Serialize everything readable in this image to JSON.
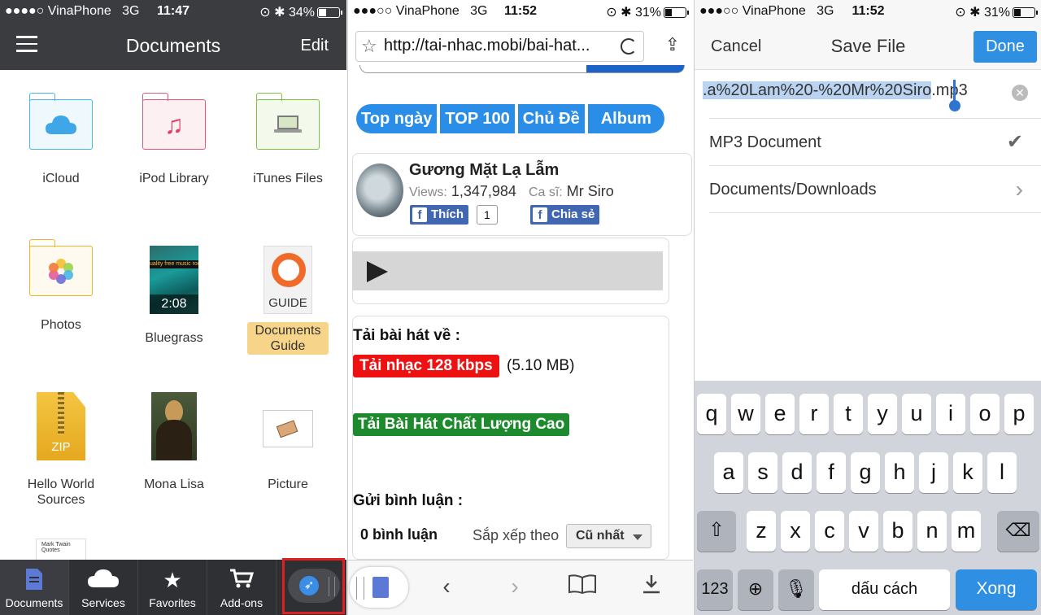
{
  "panel1": {
    "status": {
      "carrier": "●●●●○ VinaPhone",
      "network": "3G",
      "time": "11:47",
      "battery": "34%",
      "battery_level": 0.34
    },
    "header": {
      "title": "Documents",
      "edit": "Edit"
    },
    "items": [
      {
        "label": "iCloud"
      },
      {
        "label": "iPod Library"
      },
      {
        "label": "iTunes Files"
      },
      {
        "label": "Photos"
      },
      {
        "label": "Bluegrass",
        "duration": "2:08",
        "caption": "uality free music room"
      },
      {
        "label": "Documents Guide",
        "badge": "GUIDE"
      },
      {
        "label": "Hello World Sources",
        "badge": "ZIP"
      },
      {
        "label": "Mona Lisa"
      },
      {
        "label": "Picture"
      },
      {
        "label": "Mark Twain Quotes"
      }
    ],
    "tabs": [
      {
        "label": "Documents",
        "icon": "document-icon"
      },
      {
        "label": "Services",
        "icon": "cloud-icon"
      },
      {
        "label": "Favorites",
        "icon": "star-icon"
      },
      {
        "label": "Add-ons",
        "icon": "cart-icon"
      }
    ]
  },
  "panel2": {
    "status": {
      "carrier": "●●●○○ VinaPhone",
      "network": "3G",
      "time": "11:52",
      "battery": "31%",
      "battery_level": 0.31
    },
    "url": "http://tai-nhac.mobi/bai-hat...",
    "nav": [
      "Top ngày",
      "TOP 100",
      "Chủ Đề",
      "Album"
    ],
    "song": {
      "title": "Gương Mặt Lạ Lẫm",
      "views_label": "Views:",
      "views": "1,347,984",
      "singer_label": "Ca sĩ:",
      "singer": "Mr Siro",
      "like_label": "Thích",
      "like_count": "1",
      "share_label": "Chia sẻ"
    },
    "download": {
      "title": "Tải bài hát về :",
      "btn128": "Tải nhạc 128 kbps",
      "size": "(5.10 MB)",
      "btn_hq": "Tải Bài Hát Chất Lượng Cao"
    },
    "comments": {
      "title": "Gửi bình luận :",
      "count": "0 bình luận",
      "sort_label": "Sắp xếp theo",
      "sort_value": "Cũ nhất"
    }
  },
  "panel3": {
    "status": {
      "carrier": "●●●○○ VinaPhone",
      "network": "3G",
      "time": "11:52",
      "battery": "31%",
      "battery_level": 0.31
    },
    "header": {
      "cancel": "Cancel",
      "title": "Save File",
      "done": "Done"
    },
    "filename_selected": ".a%20Lam%20-%20Mr%20Siro",
    "filename_ext": ".mp3",
    "type": "MP3 Document",
    "location": "Documents/Downloads",
    "keyboard": {
      "row1": [
        "q",
        "w",
        "e",
        "r",
        "t",
        "y",
        "u",
        "i",
        "o",
        "p"
      ],
      "row2": [
        "a",
        "s",
        "d",
        "f",
        "g",
        "h",
        "j",
        "k",
        "l"
      ],
      "row3": [
        "z",
        "x",
        "c",
        "v",
        "b",
        "n",
        "m"
      ],
      "numbers": "123",
      "space": "dấu cách",
      "return": "Xong"
    }
  }
}
